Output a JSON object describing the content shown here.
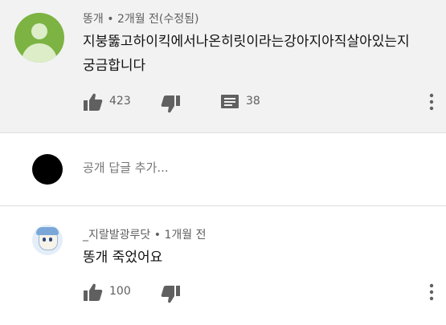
{
  "comment": {
    "author": "똥개",
    "time": "2개월 전(수정됨)",
    "text": "지붕뚫고하이킥에서나온히릿이라는강아지아직살아있는지궁금합니다",
    "likes": "423",
    "replies": "38"
  },
  "reply_box": {
    "placeholder": "공개 답글 추가..."
  },
  "reply": {
    "author": "_지랄발광루닷",
    "time": "1개월 전",
    "text": "똥개 죽었어요",
    "likes": "100"
  },
  "icons": [
    "avatar-default-icon",
    "thumb-up-icon",
    "thumb-down-icon",
    "reply-icon",
    "more-vert-icon"
  ],
  "colors": {
    "secondary_text": "#606060",
    "comment_bg": "#f2f2f2",
    "avatar_green": "#7cb342"
  }
}
